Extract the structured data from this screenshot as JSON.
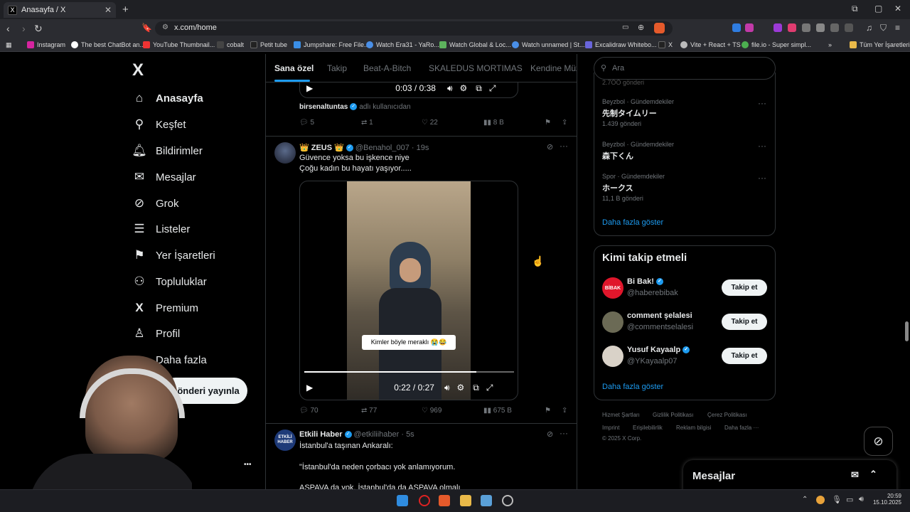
{
  "browser": {
    "tab_title": "Anasayfa / X",
    "tab_icon": "X",
    "tab_close": "✕",
    "new_tab": "+",
    "url": "x.com/home",
    "bookmarks": [
      "Instagram",
      "The best ChatBot an...",
      "YouTube Thumbnail...",
      "cobalt",
      "Petit tube",
      "Jumpshare: Free File...",
      "Watch Era31 - YaRo...",
      "Watch Global & Loc...",
      "Watch unnamed | St...",
      "Excalidraw Whitebo...",
      "X",
      "Vite + React + TS",
      "file.io - Super simpl..."
    ],
    "bookmarks_more": "»",
    "all_bookmarks": "Tüm Yer İşaretleri"
  },
  "sidebar": {
    "logo": "X",
    "items": [
      {
        "label": "Anasayfa",
        "icon": "home-icon",
        "glyph": "⌂",
        "active": true
      },
      {
        "label": "Keşfet",
        "icon": "search-icon",
        "glyph": "⚲"
      },
      {
        "label": "Bildirimler",
        "icon": "bell-icon",
        "glyph": "♫"
      },
      {
        "label": "Mesajlar",
        "icon": "mail-icon",
        "glyph": "✉"
      },
      {
        "label": "Grok",
        "icon": "grok-icon",
        "glyph": "⊘"
      },
      {
        "label": "Listeler",
        "icon": "list-icon",
        "glyph": "☰"
      },
      {
        "label": "Yer İşaretleri",
        "icon": "bookmark-icon",
        "glyph": "⚑"
      },
      {
        "label": "Topluluklar",
        "icon": "communities-icon",
        "glyph": "⚇"
      },
      {
        "label": "Premium",
        "icon": "x-premium-icon",
        "glyph": "X"
      },
      {
        "label": "Profil",
        "icon": "profile-icon",
        "glyph": "♙"
      },
      {
        "label": "Daha fazla",
        "icon": "more-icon",
        "glyph": "⋯"
      }
    ],
    "post_button": "Gönderi yayınla",
    "account_more": "•••"
  },
  "timeline": {
    "tabs": [
      "Sana özel",
      "Takip",
      "Beat-A-Bitch",
      "SKALEDUS MORTIMAS",
      "Kendine Müz"
    ],
    "prev_post": {
      "video_time": "0:03 / 0:38",
      "author": "birsenaltuntas",
      "author_suffix": "adlı kullanıcıdan",
      "replies": "5",
      "reposts": "1",
      "likes": "22",
      "views": "8 B"
    },
    "post1": {
      "name": "👑 ZEUS 👑",
      "handle": "@Benahol_007",
      "time": "· 19s",
      "line1": "Güvence yoksa bu  işkence niye",
      "line2": "Çoğu kadın bu hayatı yaşıyor.....",
      "caption": "Kimler böyle meraklı 😭😂",
      "video_time": "0:22 / 0:27",
      "progress": 0.82,
      "replies": "70",
      "reposts": "77",
      "likes": "969",
      "views": "675 B"
    },
    "post2": {
      "name": "Etkili Haber",
      "handle": "@etkiliihaber",
      "time": "· 5s",
      "line1": "İstanbul'a taşınan Ankaralı:",
      "line2": "\"İstanbul'da neden çorbacı yok anlamıyorum.",
      "line3": "ASPAVA da yok, İstanbul'da da ASPAVA olmalı"
    }
  },
  "right": {
    "search_placeholder": "Ara",
    "trends_top_count": "2.7ÖÖ gönderi",
    "trends": [
      {
        "category": "Beyzbol · Gündemdekiler",
        "name": "先制タイムリー",
        "count": "1.439 gönderi"
      },
      {
        "category": "Beyzbol · Gündemdekiler",
        "name": "森下くん",
        "count": ""
      },
      {
        "category": "Spor · Gündemdekiler",
        "name": "ホークス",
        "count": "11,1 B gönderi"
      }
    ],
    "show_more": "Daha fazla göster",
    "who_to_follow_title": "Kimi takip etmeli",
    "follow": [
      {
        "name": "Bi Bak!",
        "handle": "@haberebibak",
        "verified": true,
        "avatar_text": "BİBAK",
        "avatar_color": "#e0162b"
      },
      {
        "name": "comment şelalesi",
        "handle": "@commentselalesi",
        "verified": false,
        "avatar_text": "",
        "avatar_color": "#6b6a55"
      },
      {
        "name": "Yusuf Kayaalp",
        "handle": "@YKayaalp07",
        "verified": true,
        "avatar_text": "",
        "avatar_color": "#d9d2c8"
      }
    ],
    "follow_button": "Takip et",
    "footer": [
      "Hizmet Şartları",
      "Gizlilik Politikası",
      "Çerez Politikası",
      "Imprint",
      "Erişilebilirlik",
      "Reklam bilgisi",
      "Daha fazla ···",
      "© 2025 X Corp."
    ],
    "dm_title": "Mesajlar"
  },
  "taskbar": {
    "time": "20:59",
    "date": "15.10.2025"
  },
  "colors": {
    "accent": "#1d9bf0",
    "background": "#000000",
    "text": "#e7e9ea",
    "muted": "#71767b",
    "border": "#2f3336"
  }
}
